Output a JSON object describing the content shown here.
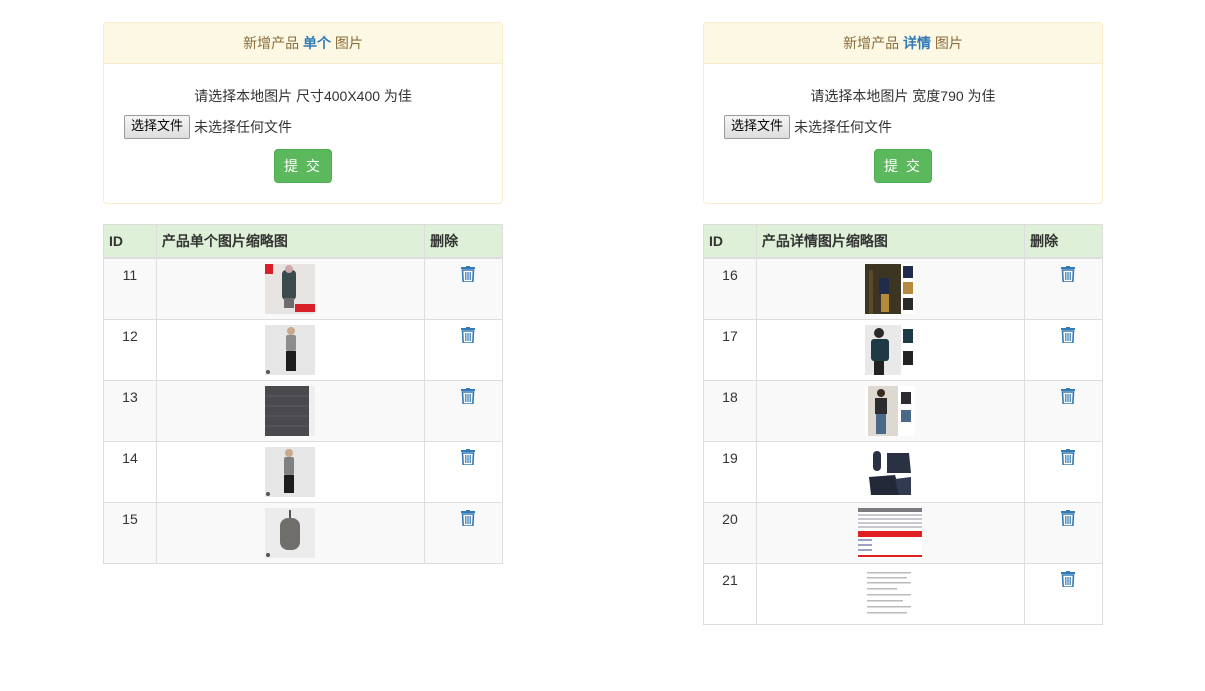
{
  "left": {
    "heading_prefix": "新增产品",
    "heading_highlight": "单个",
    "heading_suffix": "图片",
    "hint": "请选择本地图片 尺寸400X400 为佳",
    "file_button": "选择文件",
    "file_status": "未选择任何文件",
    "submit": "提 交",
    "columns": [
      "ID",
      "产品单个图片缩略图",
      "删除"
    ],
    "rows": [
      {
        "id": "11",
        "thumb": "product-photo-red-banner"
      },
      {
        "id": "12",
        "thumb": "product-photo-model-skirt"
      },
      {
        "id": "13",
        "thumb": "product-photo-down-vest"
      },
      {
        "id": "14",
        "thumb": "product-photo-model-skirt"
      },
      {
        "id": "15",
        "thumb": "product-photo-pouch"
      }
    ]
  },
  "right": {
    "heading_prefix": "新增产品",
    "heading_highlight": "详情",
    "heading_suffix": "图片",
    "hint": "请选择本地图片 宽度790 为佳",
    "file_button": "选择文件",
    "file_status": "未选择任何文件",
    "submit": "提 交",
    "columns": [
      "ID",
      "产品详情图片缩略图",
      "删除"
    ],
    "rows": [
      {
        "id": "16",
        "thumb": "detail-photo-outdoor"
      },
      {
        "id": "17",
        "thumb": "detail-photo-jacket"
      },
      {
        "id": "18",
        "thumb": "detail-photo-street"
      },
      {
        "id": "19",
        "thumb": "detail-photo-folded"
      },
      {
        "id": "20",
        "thumb": "detail-size-chart"
      },
      {
        "id": "21",
        "thumb": "detail-text-sheet"
      }
    ]
  },
  "icons": {
    "delete": "trash-icon"
  },
  "colors": {
    "warning_bg": "#fcf8e3",
    "header_bg": "#dff0d8",
    "submit": "#5cb85c",
    "link": "#337ab7"
  }
}
